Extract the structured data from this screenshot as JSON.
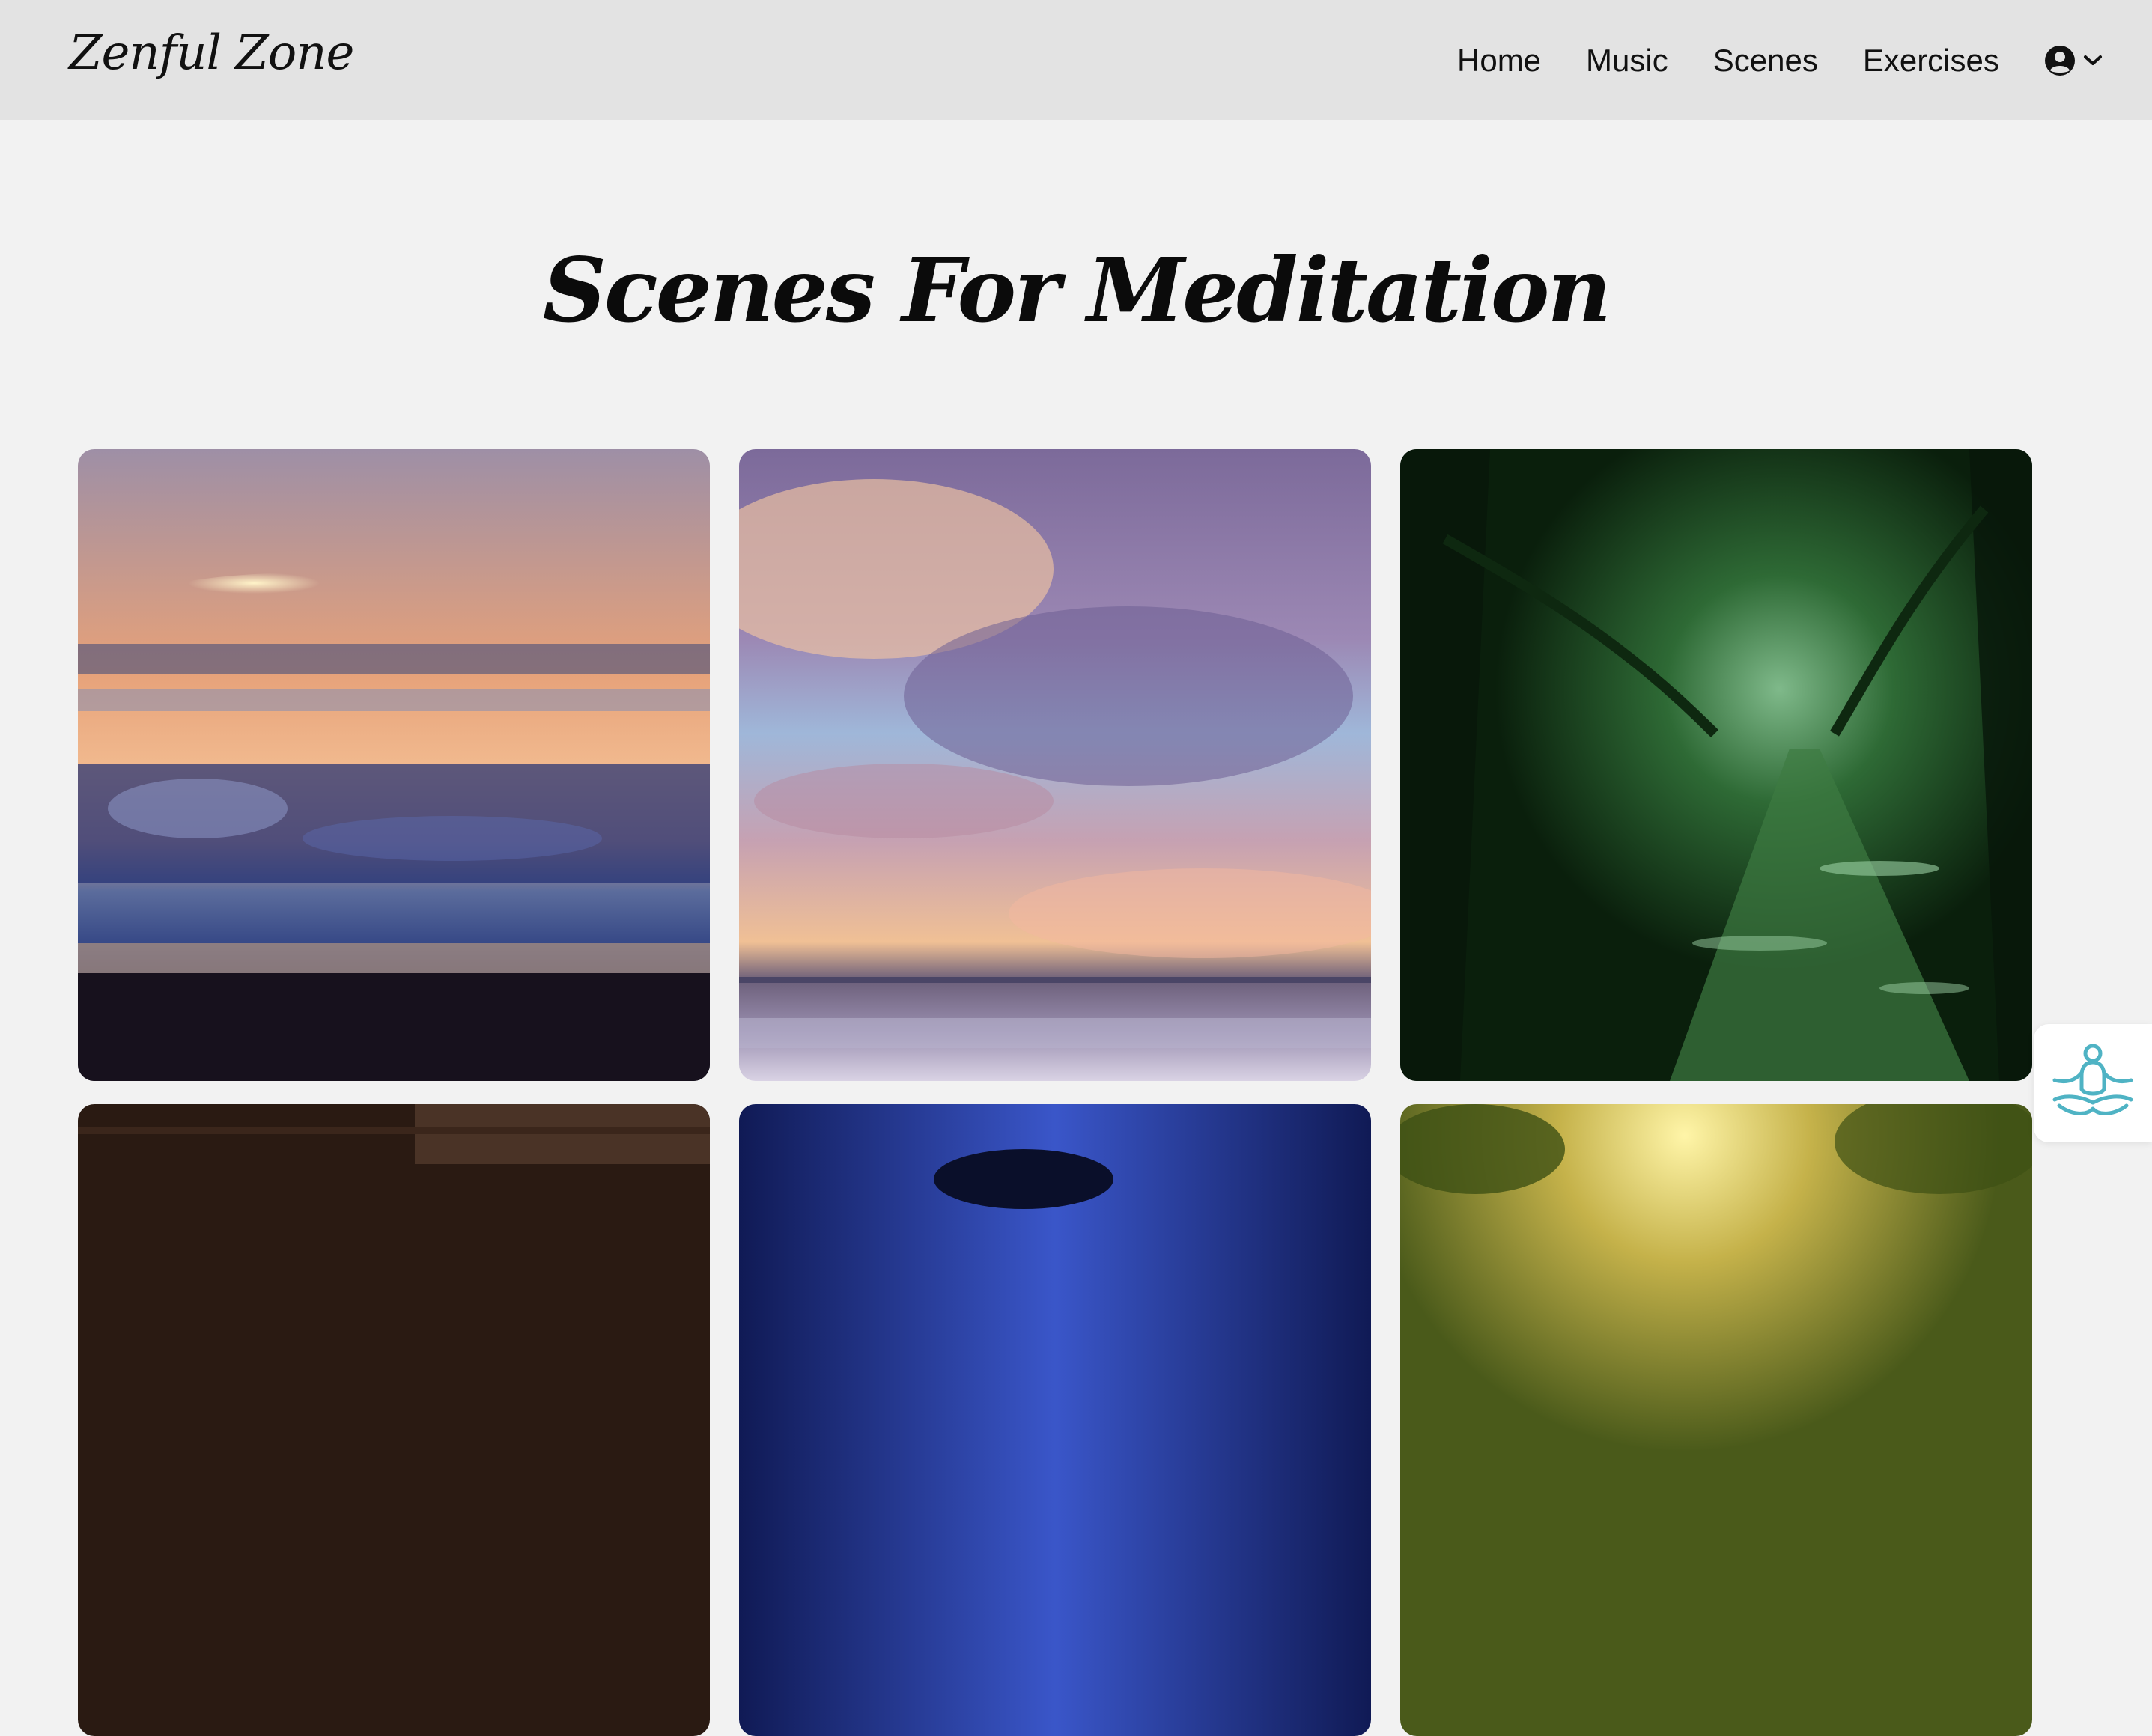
{
  "brand": {
    "name": "Zenful Zone"
  },
  "nav": {
    "items": [
      {
        "label": "Home"
      },
      {
        "label": "Music"
      },
      {
        "label": "Scenes"
      },
      {
        "label": "Exercises"
      }
    ],
    "account_icon": "user-circle-icon",
    "account_dropdown_icon": "chevron-down-icon"
  },
  "page": {
    "title": "Scenes For Meditation"
  },
  "scenes": [
    {
      "name": "ocean-waves-sunset-scene"
    },
    {
      "name": "sunset-clouds-sea-scene"
    },
    {
      "name": "forest-path-scene"
    },
    {
      "name": "dark-wooden-cabin-scene"
    },
    {
      "name": "blue-cave-scene"
    },
    {
      "name": "sunlit-jungle-scene"
    }
  ],
  "floating_button": {
    "icon": "meditation-figure-icon"
  },
  "colors": {
    "navbar_bg": "#e3e3e3",
    "page_bg": "#f2f2f2",
    "text": "#111111",
    "meditation_icon": "#4fb3c4"
  }
}
